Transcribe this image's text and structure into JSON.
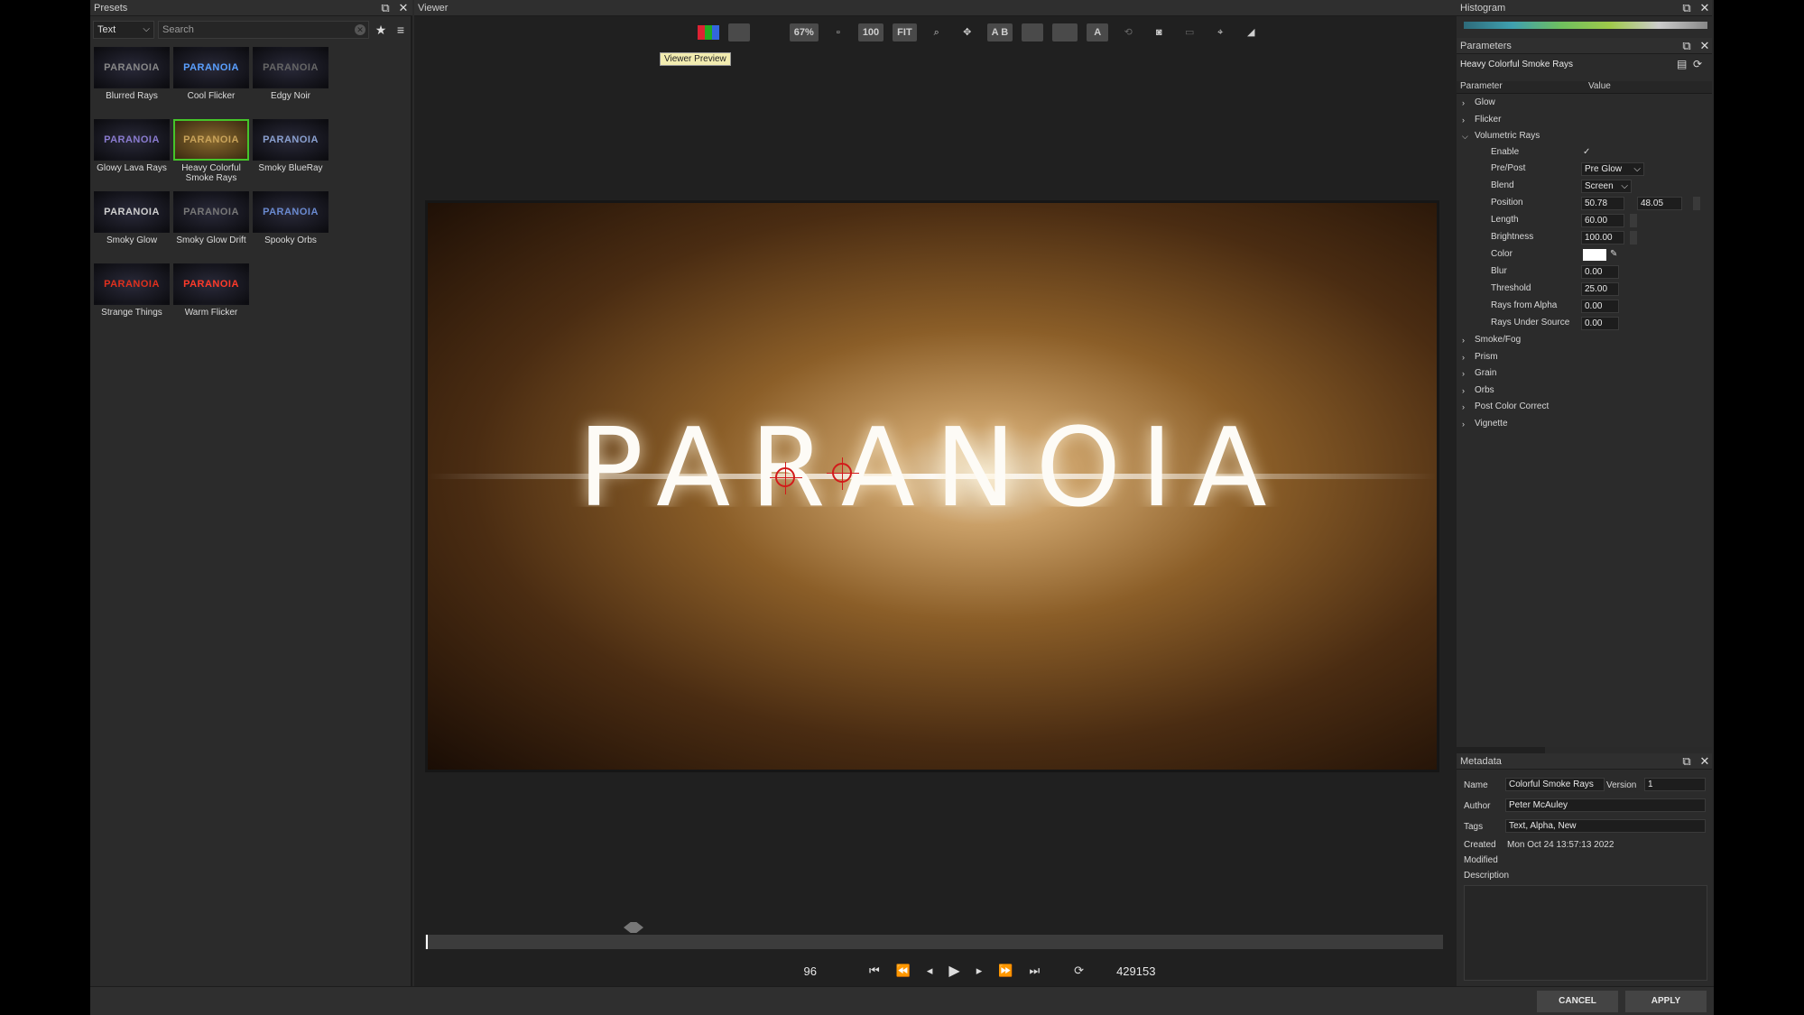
{
  "presets": {
    "title": "Presets",
    "category": "Text",
    "search_placeholder": "Search",
    "items": [
      {
        "label": "Blurred Rays",
        "thumb_color": "#888888"
      },
      {
        "label": "Cool Flicker",
        "thumb_color": "#5aa0ff"
      },
      {
        "label": "Edgy Noir",
        "thumb_color": "#666666"
      },
      {
        "label": "Glowy Lava Rays",
        "thumb_color": "#8a7bd0"
      },
      {
        "label": "Heavy Colorful Smoke Rays",
        "thumb_color": "#c9a35a"
      },
      {
        "label": "Smoky BlueRay",
        "thumb_color": "#8aa0d0"
      },
      {
        "label": "Smoky Glow",
        "thumb_color": "#cfcfcf"
      },
      {
        "label": "Smoky Glow Drift",
        "thumb_color": "#777777"
      },
      {
        "label": "Spooky Orbs",
        "thumb_color": "#6a8ad0"
      },
      {
        "label": "Strange Things",
        "thumb_color": "#e0301e"
      },
      {
        "label": "Warm Flicker",
        "thumb_color": "#ff3a2a"
      }
    ],
    "thumb_text": "PARANOIA",
    "selected_index": 4
  },
  "viewer": {
    "title": "Viewer",
    "zoom": "67%",
    "btn_100": "100",
    "btn_fit": "FIT",
    "btn_ab": "A B",
    "tooltip": "Viewer Preview",
    "canvas_text": "PARANOIA",
    "frame": "96",
    "end_frame": "429153"
  },
  "histogram": {
    "title": "Histogram"
  },
  "parameters": {
    "title": "Parameters",
    "preset_name": "Heavy Colorful Smoke Rays",
    "col_param": "Parameter",
    "col_value": "Value",
    "groups_top": [
      "Glow",
      "Flicker",
      "Volumetric Rays"
    ],
    "volumetric": {
      "enable_label": "Enable",
      "prepost_label": "Pre/Post",
      "prepost_value": "Pre Glow",
      "blend_label": "Blend",
      "blend_value": "Screen",
      "position_label": "Position",
      "position_x": "50.78",
      "position_y": "48.05",
      "length_label": "Length",
      "length_value": "60.00",
      "brightness_label": "Brightness",
      "brightness_value": "100.00",
      "color_label": "Color",
      "blur_label": "Blur",
      "blur_value": "0.00",
      "threshold_label": "Threshold",
      "threshold_value": "25.00",
      "rfa_label": "Rays from Alpha",
      "rfa_value": "0.00",
      "rus_label": "Rays Under Source",
      "rus_value": "0.00"
    },
    "groups_bottom": [
      "Smoke/Fog",
      "Prism",
      "Grain",
      "Orbs",
      "Post Color Correct",
      "Vignette"
    ]
  },
  "metadata": {
    "title": "Metadata",
    "name_label": "Name",
    "name_value": "Colorful Smoke Rays",
    "version_label": "Version",
    "version_value": "1",
    "author_label": "Author",
    "author_value": "Peter McAuley",
    "tags_label": "Tags",
    "tags_value": "Text, Alpha, New",
    "created_label": "Created",
    "created_value": "Mon Oct 24 13:57:13 2022",
    "modified_label": "Modified",
    "description_label": "Description"
  },
  "footer": {
    "cancel": "CANCEL",
    "apply": "APPLY"
  }
}
